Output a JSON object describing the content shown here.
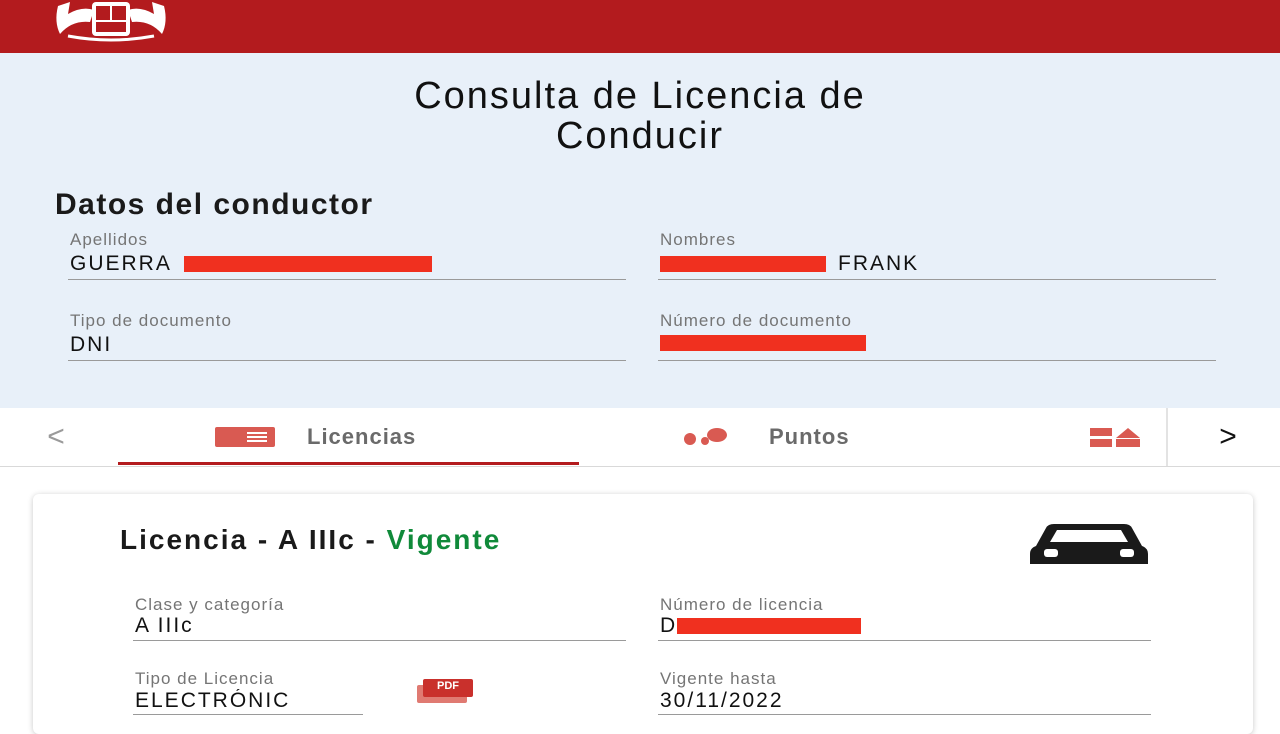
{
  "page": {
    "title_line1": "Consulta de Licencia de",
    "title_line2": "Conducir"
  },
  "conductor": {
    "section_title": "Datos del conductor",
    "apellidos_label": "Apellidos",
    "apellidos_value": "GUERRA",
    "nombres_label": "Nombres",
    "nombres_value": "FRANK",
    "tipo_doc_label": "Tipo de documento",
    "tipo_doc_value": "DNI",
    "numero_doc_label": "Número de documento"
  },
  "tabs": {
    "prev_arrow": "<",
    "licencias_label": "Licencias",
    "puntos_label": "Puntos",
    "next_arrow": ">",
    "active": "Licencias"
  },
  "license_card": {
    "title_prefix": "Licencia - A IIIc - ",
    "status": "Vigente",
    "clase_label": "Clase y categoría",
    "clase_value": "A IIIc",
    "numero_label": "Número de licencia",
    "numero_value_prefix": "D",
    "tipo_label": "Tipo de Licencia",
    "tipo_value": "ELECTRÓNIC",
    "pdf_badge": "PDF",
    "vigente_label": "Vigente hasta",
    "vigente_value": "30/11/2022"
  },
  "colors": {
    "brand_red": "#b31b1e",
    "status_green": "#108a3a",
    "redaction": "#f0301f",
    "header_bg": "#e8f0f9"
  },
  "icons": [
    "emblem-icon",
    "license-card-icon",
    "points-icon",
    "more-grid-icon",
    "car-icon",
    "pdf-icon"
  ]
}
